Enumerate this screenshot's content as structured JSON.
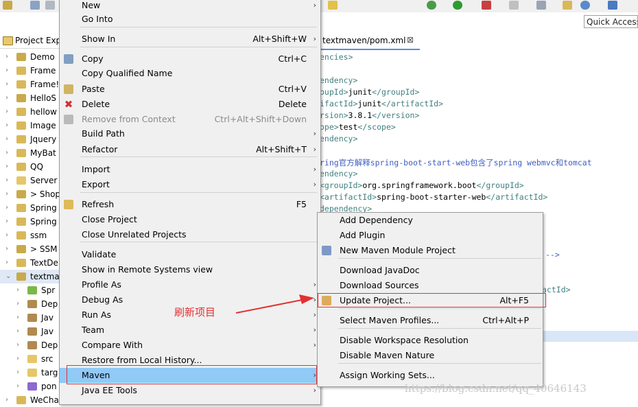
{
  "toolbar": {
    "quick_access": "Quick Access"
  },
  "project_explorer": {
    "tab_label": "Project Exp",
    "items": [
      {
        "label": "Demo",
        "kind": "maven"
      },
      {
        "label": "Frame",
        "kind": "java"
      },
      {
        "label": "Frame!",
        "kind": "java"
      },
      {
        "label": "HelloS",
        "kind": "maven"
      },
      {
        "label": "hellow",
        "kind": "java"
      },
      {
        "label": "Image",
        "kind": "java"
      },
      {
        "label": "Jquery",
        "kind": "java"
      },
      {
        "label": "MyBat",
        "kind": "java"
      },
      {
        "label": "QQ",
        "kind": "java"
      },
      {
        "label": "Server",
        "kind": "folder"
      },
      {
        "label": "> Shop",
        "kind": "maven"
      },
      {
        "label": "Spring",
        "kind": "java"
      },
      {
        "label": "Spring",
        "kind": "java"
      },
      {
        "label": "ssm",
        "kind": "java"
      },
      {
        "label": "> SSM",
        "kind": "maven"
      },
      {
        "label": "TextDe",
        "kind": "java"
      },
      {
        "label": "textma",
        "kind": "maven"
      },
      {
        "label": "Spr",
        "kind": "leaf"
      },
      {
        "label": "Dep",
        "kind": "lib"
      },
      {
        "label": "Jav",
        "kind": "lib"
      },
      {
        "label": "Jav",
        "kind": "lib"
      },
      {
        "label": "Dep",
        "kind": "lib"
      },
      {
        "label": "src",
        "kind": "folder"
      },
      {
        "label": "targ",
        "kind": "folder"
      },
      {
        "label": "pon",
        "kind": "file"
      },
      {
        "label": "WeCha",
        "kind": "java"
      }
    ]
  },
  "editor": {
    "tab_label": "textmaven/pom.xml",
    "close_glyph": "⊠",
    "lines": [
      {
        "parts": [
          {
            "c": "tag",
            "t": "encies>"
          }
        ]
      },
      {
        "parts": []
      },
      {
        "parts": [
          {
            "c": "tag",
            "t": "endency>"
          }
        ]
      },
      {
        "parts": [
          {
            "c": "tag",
            "t": "oupId>"
          },
          {
            "c": "txt",
            "t": "junit"
          },
          {
            "c": "tag",
            "t": "</groupId>"
          }
        ]
      },
      {
        "parts": [
          {
            "c": "tag",
            "t": "ifactId>"
          },
          {
            "c": "txt",
            "t": "junit"
          },
          {
            "c": "tag",
            "t": "</artifactId>"
          }
        ]
      },
      {
        "parts": [
          {
            "c": "tag",
            "t": "rsion>"
          },
          {
            "c": "txt",
            "t": "3.8.1"
          },
          {
            "c": "tag",
            "t": "</version>"
          }
        ]
      },
      {
        "parts": [
          {
            "c": "tag",
            "t": "ope>"
          },
          {
            "c": "txt",
            "t": "test"
          },
          {
            "c": "tag",
            "t": "</scope>"
          }
        ]
      },
      {
        "parts": [
          {
            "c": "tag",
            "t": "endency>"
          }
        ]
      },
      {
        "parts": []
      },
      {
        "parts": [
          {
            "c": "cmt",
            "t": "ring官方解释spring-boot-start-web包含了spring webmvc和tomcat"
          }
        ]
      },
      {
        "parts": [
          {
            "c": "tag",
            "t": "endency>"
          }
        ]
      },
      {
        "parts": [
          {
            "c": "tag",
            "t": " <groupId>"
          },
          {
            "c": "txt",
            "t": "org.springframework.boot"
          },
          {
            "c": "tag",
            "t": "</groupId>"
          }
        ]
      },
      {
        "parts": [
          {
            "c": "tag",
            "t": "  <artifactId>"
          },
          {
            "c": "txt",
            "t": "spring-boot-starter-web"
          },
          {
            "c": "tag",
            "t": "</artifactId>"
          }
        ]
      },
      {
        "parts": [
          {
            "c": "tag",
            "t": "dependency>"
          }
        ]
      }
    ],
    "fragment_1": "-->",
    "fragment_2": "actId>"
  },
  "context_menu": {
    "items": [
      {
        "label": "New",
        "shortcut": "",
        "submenu": true,
        "icon": ""
      },
      {
        "label": "Go Into",
        "shortcut": "",
        "submenu": false,
        "icon": ""
      },
      {
        "label": "Show In",
        "shortcut": "Alt+Shift+W",
        "submenu": true,
        "icon": ""
      },
      {
        "label": "Copy",
        "shortcut": "Ctrl+C",
        "submenu": false,
        "icon": "copy-icon"
      },
      {
        "label": "Copy Qualified Name",
        "shortcut": "",
        "submenu": false,
        "icon": ""
      },
      {
        "label": "Paste",
        "shortcut": "Ctrl+V",
        "submenu": false,
        "icon": "paste-icon"
      },
      {
        "label": "Delete",
        "shortcut": "Delete",
        "submenu": false,
        "icon": "delete-icon"
      },
      {
        "label": "Remove from Context",
        "shortcut": "Ctrl+Alt+Shift+Down",
        "submenu": false,
        "icon": "remove-context-icon",
        "disabled": true
      },
      {
        "label": "Build Path",
        "shortcut": "",
        "submenu": true,
        "icon": ""
      },
      {
        "label": "Refactor",
        "shortcut": "Alt+Shift+T",
        "submenu": true,
        "icon": ""
      },
      {
        "label": "Import",
        "shortcut": "",
        "submenu": true,
        "icon": ""
      },
      {
        "label": "Export",
        "shortcut": "",
        "submenu": true,
        "icon": ""
      },
      {
        "label": "Refresh",
        "shortcut": "F5",
        "submenu": false,
        "icon": "refresh-icon"
      },
      {
        "label": "Close Project",
        "shortcut": "",
        "submenu": false,
        "icon": ""
      },
      {
        "label": "Close Unrelated Projects",
        "shortcut": "",
        "submenu": false,
        "icon": ""
      },
      {
        "label": "Validate",
        "shortcut": "",
        "submenu": false,
        "icon": ""
      },
      {
        "label": "Show in Remote Systems view",
        "shortcut": "",
        "submenu": false,
        "icon": ""
      },
      {
        "label": "Profile As",
        "shortcut": "",
        "submenu": true,
        "icon": ""
      },
      {
        "label": "Debug As",
        "shortcut": "",
        "submenu": true,
        "icon": ""
      },
      {
        "label": "Run As",
        "shortcut": "",
        "submenu": true,
        "icon": ""
      },
      {
        "label": "Team",
        "shortcut": "",
        "submenu": true,
        "icon": ""
      },
      {
        "label": "Compare With",
        "shortcut": "",
        "submenu": true,
        "icon": ""
      },
      {
        "label": "Restore from Local History...",
        "shortcut": "",
        "submenu": false,
        "icon": ""
      },
      {
        "label": "Maven",
        "shortcut": "",
        "submenu": true,
        "icon": "",
        "selected": true
      },
      {
        "label": "Java EE Tools",
        "shortcut": "",
        "submenu": true,
        "icon": ""
      }
    ]
  },
  "maven_submenu": {
    "items": [
      {
        "label": "Add Dependency",
        "shortcut": "",
        "icon": ""
      },
      {
        "label": "Add Plugin",
        "shortcut": "",
        "icon": ""
      },
      {
        "label": "New Maven Module Project",
        "shortcut": "",
        "icon": "maven-module-icon"
      },
      {
        "label": "Download JavaDoc",
        "shortcut": "",
        "icon": ""
      },
      {
        "label": "Download Sources",
        "shortcut": "",
        "icon": ""
      },
      {
        "label": "Update Project...",
        "shortcut": "Alt+F5",
        "icon": "update-project-icon"
      },
      {
        "label": "Select Maven Profiles...",
        "shortcut": "Ctrl+Alt+P",
        "icon": ""
      },
      {
        "label": "Disable Workspace Resolution",
        "shortcut": "",
        "icon": ""
      },
      {
        "label": "Disable Maven Nature",
        "shortcut": "",
        "icon": ""
      },
      {
        "label": "Assign Working Sets...",
        "shortcut": "",
        "icon": ""
      }
    ]
  },
  "annotation": {
    "text": "刷新项目",
    "color": "#e53030"
  },
  "watermark": "https://blog.csdn.net/qq_40646143"
}
